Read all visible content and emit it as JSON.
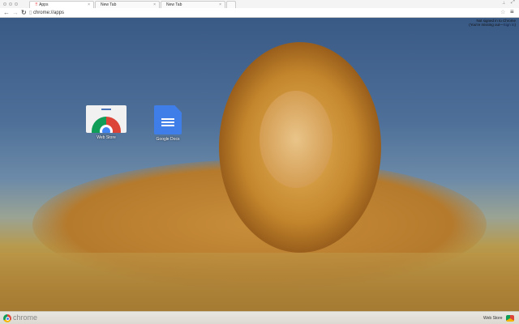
{
  "tabs": [
    {
      "label": "Apps",
      "active": true
    },
    {
      "label": "New Tab",
      "active": false
    },
    {
      "label": "New Tab",
      "active": false
    }
  ],
  "toolbar": {
    "url": "chrome://apps"
  },
  "signin": {
    "line1": "Not signed in to Chrome",
    "line2": "(You're missing out—",
    "link": "Sign in",
    "line2_end": ")"
  },
  "apps": [
    {
      "label": "Web Store",
      "icon": "chrome-web-store-icon"
    },
    {
      "label": "Google Docs",
      "icon": "google-docs-icon"
    }
  ],
  "bottombar": {
    "logo_text": "chrome",
    "launcher_label": "Web Store"
  },
  "colors": {
    "sky": "#3a5a86",
    "grass": "#b89a4c",
    "docs_blue": "#3f7ee8"
  }
}
